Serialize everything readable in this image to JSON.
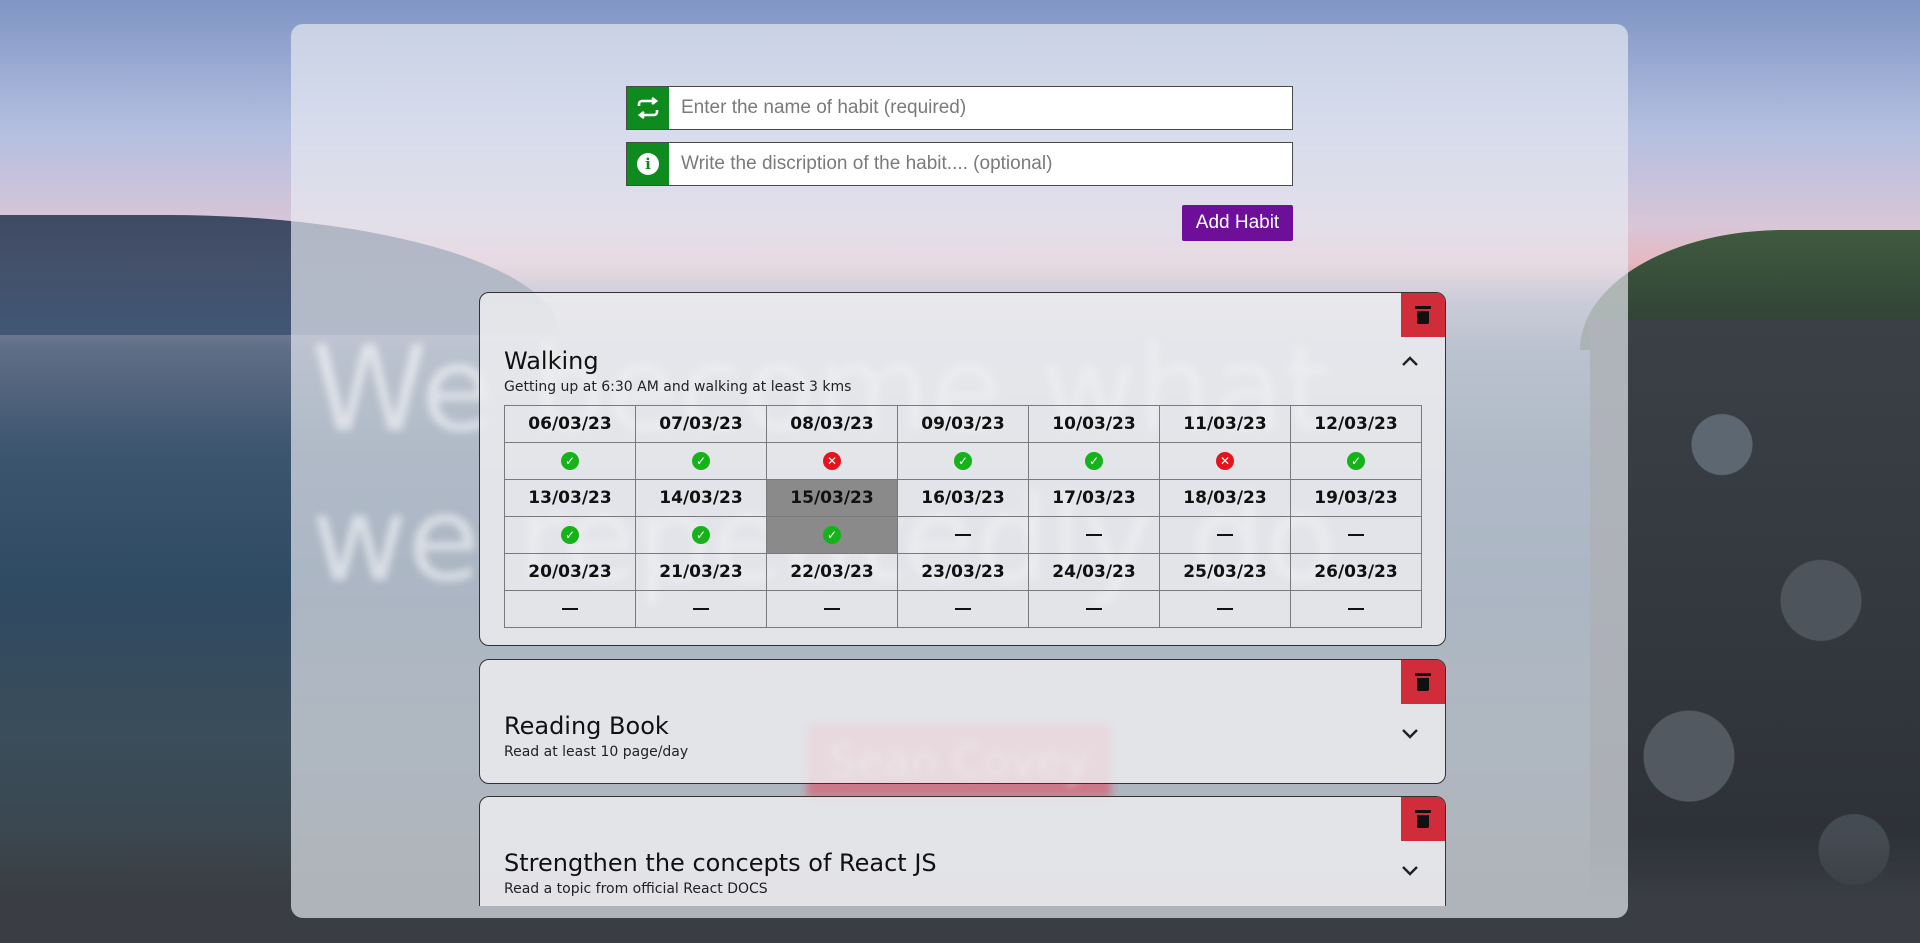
{
  "background": {
    "quote_line1": "We become what",
    "quote_line2": "we repeatedly do.",
    "quote_author": "Sean Covey"
  },
  "form": {
    "habit_name_placeholder": "Enter the name of habit (required)",
    "habit_name_value": "",
    "habit_desc_placeholder": "Write the discription of the habit.... (optional)",
    "habit_desc_value": "",
    "add_button": "Add Habit"
  },
  "colors": {
    "accent_green": "#0f8a1f",
    "button_purple": "#6d0f99",
    "delete_red": "#d02c39",
    "done_green": "#15b21a",
    "missed_red": "#e3141d"
  },
  "habits": [
    {
      "title": "Walking",
      "description": "Getting up at 6:30 AM and walking at least 3 kms",
      "expanded": true,
      "weeks": [
        {
          "dates": [
            "06/03/23",
            "07/03/23",
            "08/03/23",
            "09/03/23",
            "10/03/23",
            "11/03/23",
            "12/03/23"
          ],
          "status": [
            "done",
            "done",
            "missed",
            "done",
            "done",
            "missed",
            "done"
          ]
        },
        {
          "dates": [
            "13/03/23",
            "14/03/23",
            "15/03/23",
            "16/03/23",
            "17/03/23",
            "18/03/23",
            "19/03/23"
          ],
          "status": [
            "done",
            "done",
            "done",
            "none",
            "none",
            "none",
            "none"
          ]
        },
        {
          "dates": [
            "20/03/23",
            "21/03/23",
            "22/03/23",
            "23/03/23",
            "24/03/23",
            "25/03/23",
            "26/03/23"
          ],
          "status": [
            "none",
            "none",
            "none",
            "none",
            "none",
            "none",
            "none"
          ]
        }
      ],
      "selected_date": "15/03/23"
    },
    {
      "title": "Reading Book",
      "description": "Read at least 10 page/day",
      "expanded": false
    },
    {
      "title": "Strengthen the concepts of React JS",
      "description": "Read a topic from official React DOCS",
      "expanded": false
    }
  ],
  "icons": {
    "repeat": "repeat-icon",
    "info": "info-icon",
    "delete": "trash-icon",
    "collapse": "chevron-up-icon",
    "expand": "chevron-down-icon",
    "done": "check-circle-icon",
    "missed": "x-circle-icon",
    "pending": "dash-icon"
  }
}
